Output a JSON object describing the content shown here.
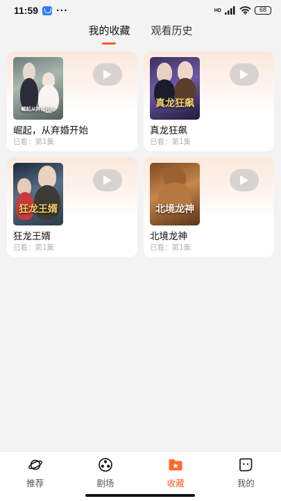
{
  "status_bar": {
    "time": "11:59",
    "dots": "···",
    "network_label": "HD",
    "battery": "68"
  },
  "tabs": [
    {
      "label": "我的收藏",
      "active": true
    },
    {
      "label": "观看历史",
      "active": false
    }
  ],
  "cards": [
    {
      "title": "崛起，从弃婚开始",
      "progress": "已看：第1集",
      "cover_text": "崛起从弃婚开始"
    },
    {
      "title": "真龙狂飙",
      "progress": "已看：第1集",
      "cover_text": "真龙狂飙"
    },
    {
      "title": "狂龙王婿",
      "progress": "已看：第1集",
      "cover_text": "狂龙王婿"
    },
    {
      "title": "北境龙神",
      "progress": "已看：第1集",
      "cover_text": "北境龙神"
    }
  ],
  "bottom_nav": [
    {
      "label": "推荐",
      "icon": "planet-icon",
      "active": false
    },
    {
      "label": "剧场",
      "icon": "film-reel-icon",
      "active": false
    },
    {
      "label": "收藏",
      "icon": "folder-star-icon",
      "active": true
    },
    {
      "label": "我的",
      "icon": "chat-face-icon",
      "active": false
    }
  ],
  "colors": {
    "accent": "#ff5a1e",
    "background": "#f3f3f3",
    "muted_text": "#b3b3b3"
  }
}
